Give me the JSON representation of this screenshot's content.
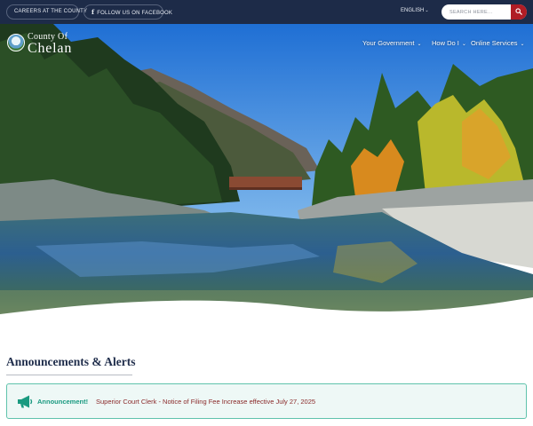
{
  "topbar": {
    "careers_label": "CAREERS AT THE COUNTY",
    "facebook_label": "FOLLOW US ON FACEBOOK",
    "facebook_icon": "f",
    "language_label": "ENGLISH",
    "language_chevron": "⌄",
    "search_placeholder": "SEARCH HERE...",
    "colors": {
      "bar": "#1d2b48",
      "search_button": "#b01d25"
    }
  },
  "header": {
    "logo_line1": "County Of",
    "logo_line2": "Chelan",
    "nav": [
      {
        "label": "Your Government",
        "chevron": "⌄"
      },
      {
        "label": "How Do I",
        "chevron": "⌄"
      },
      {
        "label": "Online Services",
        "chevron": "⌄"
      }
    ]
  },
  "announcements": {
    "heading": "Announcements & Alerts",
    "items": [
      {
        "label": "Announcement!",
        "message": "Superior Court Clerk - Notice of Filing Fee Increase effective July 27, 2025",
        "icon": "megaphone-icon"
      }
    ],
    "colors": {
      "border": "#5fc3ac",
      "label": "#1a9a80",
      "message": "#8a2a2a"
    }
  }
}
